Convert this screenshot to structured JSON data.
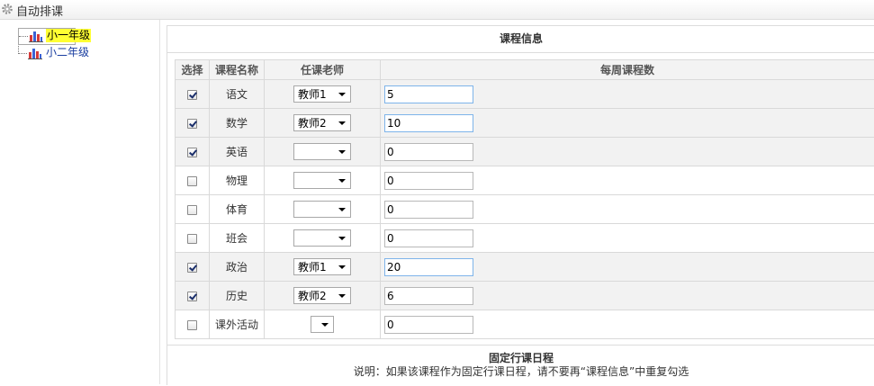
{
  "header": {
    "title": "自动排课"
  },
  "tree": {
    "items": [
      {
        "label": "小一年级",
        "selected": true
      },
      {
        "label": "小二年级",
        "selected": false
      }
    ]
  },
  "course_section": {
    "title": "课程信息",
    "columns": [
      "选择",
      "课程名称",
      "任课老师",
      "每周课程数"
    ],
    "rows": [
      {
        "checked": true,
        "name": "语文",
        "teacher": "教师1",
        "count": "5"
      },
      {
        "checked": true,
        "name": "数学",
        "teacher": "教师2",
        "count": "10"
      },
      {
        "checked": true,
        "name": "英语",
        "teacher": "",
        "count": "0"
      },
      {
        "checked": false,
        "name": "物理",
        "teacher": "",
        "count": "0"
      },
      {
        "checked": false,
        "name": "体育",
        "teacher": "",
        "count": "0"
      },
      {
        "checked": false,
        "name": "班会",
        "teacher": "",
        "count": "0"
      },
      {
        "checked": true,
        "name": "政治",
        "teacher": "教师1",
        "count": "20"
      },
      {
        "checked": true,
        "name": "历史",
        "teacher": "教师2",
        "count": "6"
      },
      {
        "checked": false,
        "name": "课外活动",
        "teacher": "",
        "count": "0"
      }
    ]
  },
  "fixed_section": {
    "title": "固定行课日程",
    "description": "说明：如果该课程作为固定行课日程，请不要再“课程信息”中重复勾选"
  },
  "colors": {
    "selected_highlight": "#ffff33",
    "link": "#1a3ea0",
    "checked_row_bg": "#f2f2f2",
    "border": "#d9d9d9"
  }
}
